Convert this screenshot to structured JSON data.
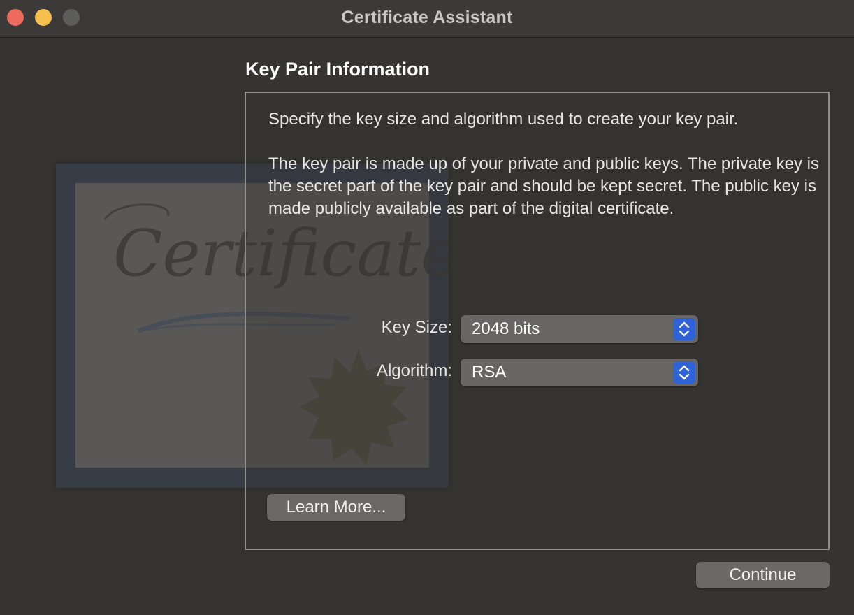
{
  "window": {
    "title": "Certificate Assistant"
  },
  "panel": {
    "heading": "Key Pair Information",
    "intro": "Specify the key size and algorithm used to create your key pair.",
    "description": "The key pair is made up of your private and public keys. The private key is the secret part of the key pair and should be kept secret. The public key is made publicly available as part of the digital certificate."
  },
  "fields": {
    "key_size_label": "Key Size:",
    "key_size_value": "2048 bits",
    "algorithm_label": "Algorithm:",
    "algorithm_value": "RSA"
  },
  "buttons": {
    "learn_more": "Learn More...",
    "continue": "Continue"
  },
  "artwork": {
    "certificate_text": "Certificate"
  },
  "colors": {
    "accent": "#2f62d6",
    "close": "#ed6a5e",
    "minimize": "#f5bf4f"
  }
}
